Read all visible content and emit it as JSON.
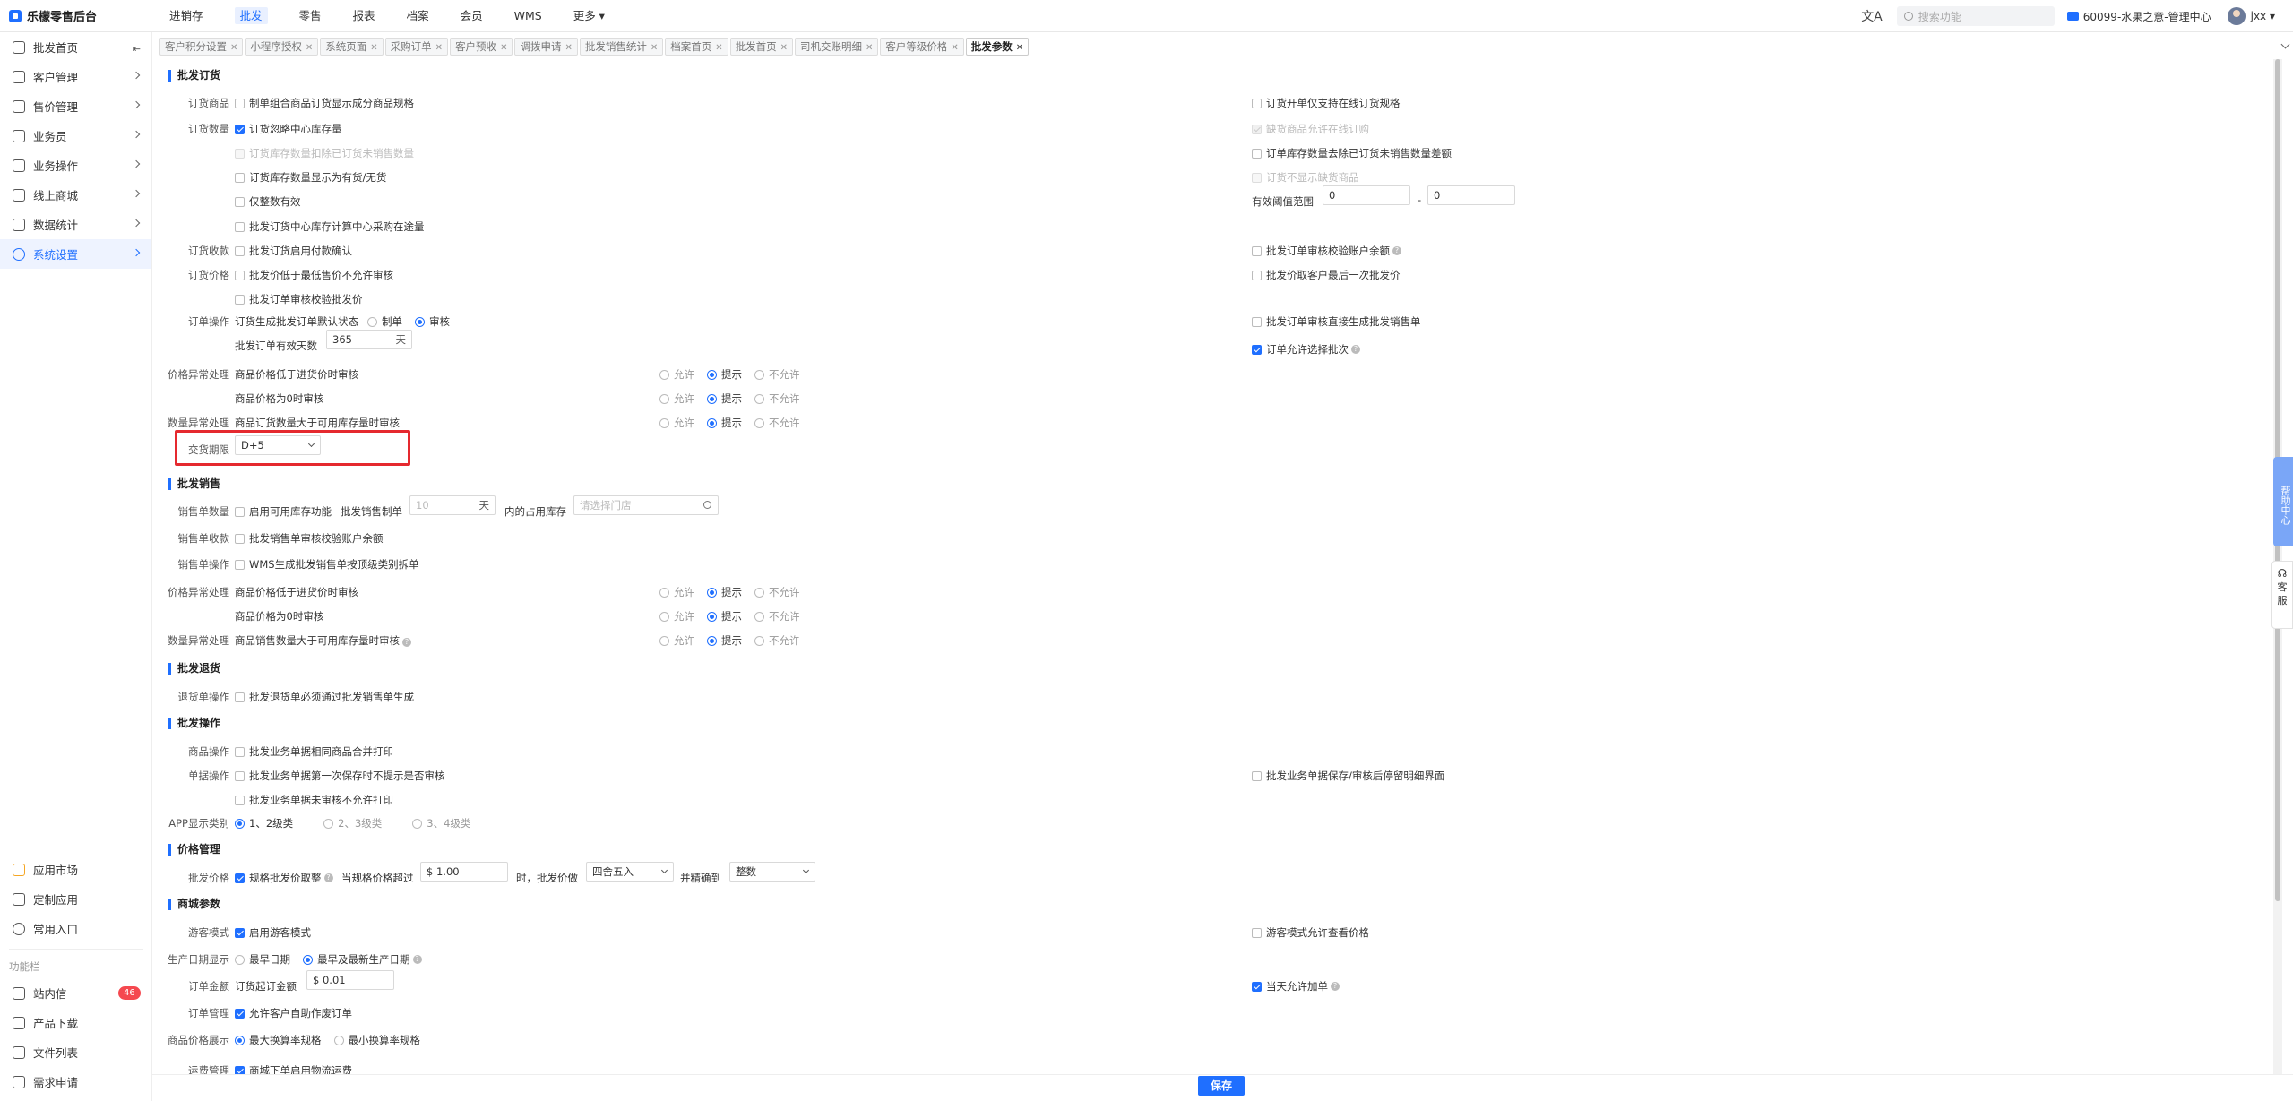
{
  "app": {
    "title": "乐檬零售后台"
  },
  "nav": [
    "进销存",
    "批发",
    "零售",
    "报表",
    "档案",
    "会员",
    "WMS",
    "更多"
  ],
  "topright": {
    "search_placeholder": "搜索功能",
    "org": "60099-水果之意-管理中心",
    "user": "jxx"
  },
  "sidebar": {
    "items": [
      "批发首页",
      "客户管理",
      "售价管理",
      "业务员",
      "业务操作",
      "线上商城",
      "数据统计",
      "系统设置"
    ],
    "bottom": [
      "应用市场",
      "定制应用",
      "常用入口"
    ],
    "section_label": "功能栏",
    "bottom2": [
      "站内信",
      "产品下载",
      "文件列表",
      "需求申请"
    ],
    "msg_badge": "46"
  },
  "tabs": [
    "客户积分设置",
    "小程序授权",
    "系统页面",
    "采购订单",
    "客户预收",
    "调拨申请",
    "批发销售统计",
    "档案首页",
    "批发首页",
    "司机交账明细",
    "客户等级价格",
    "批发参数"
  ],
  "sections": {
    "order": "批发订货",
    "sales": "批发销售",
    "returns": "批发退货",
    "ops": "批发操作",
    "price": "价格管理",
    "mall": "商城参数"
  },
  "order": {
    "row1_label": "订货商品",
    "row1_cb": "制单组合商品订货显示成分商品规格",
    "row1_right": "订货开单仅支持在线订货规格",
    "row2_label": "订货数量",
    "row2_cb1": "订货忽略中心库存量",
    "row2_right1": "缺货商品允许在线订购",
    "row2_cb2": "订货库存数量扣除已订货未销售数量",
    "row2_right2": "订单库存数量去除已订货未销售数量差额",
    "row2_cb3": "订货库存数量显示为有货/无货",
    "row2_right3": "订货不显示缺货商品",
    "row2_cb4": "仅整数有效",
    "valid_range_label": "有效阈值范围",
    "range_min": "0",
    "range_sep": "-",
    "range_max": "0",
    "row2_cb5": "批发订货中心库存计算中心采购在途量",
    "row3_label": "订货收款",
    "row3_cb": "批发订货启用付款确认",
    "row3_right": "批发订单审核校验账户余额",
    "row4_label": "订货价格",
    "row4_cb1": "批发价低于最低售价不允许审核",
    "row4_right": "批发价取客户最后一次批发价",
    "row4_cb2": "批发订单审核校验批发价",
    "row5_label": "订单操作",
    "row5_text": "订货生成批发订单默认状态",
    "row5_r1": "制单",
    "row5_r2": "审核",
    "row5_right": "批发订单审核直接生成批发销售单",
    "valid_days_label": "批发订单有效天数",
    "valid_days": "365",
    "valid_days_unit": "天",
    "row5_right2": "订单允许选择批次",
    "price_ex_label": "价格异常处理",
    "price_ex1": "商品价格低于进货价时审核",
    "price_ex2": "商品价格为0时审核",
    "qty_ex_label": "数量异常处理",
    "qty_ex1": "商品订货数量大于可用库存量时审核",
    "opt_allow": "允许",
    "opt_prompt": "提示",
    "opt_deny": "不允许",
    "delivery_label": "交货期限",
    "delivery_value": "D+5"
  },
  "sales": {
    "qty_label": "销售单数量",
    "qty_cb": "启用可用库存功能",
    "qty_text1": "批发销售制单",
    "qty_days": "10",
    "qty_unit": "天",
    "qty_text2": "内的占用库存",
    "store_placeholder": "请选择门店",
    "pay_label": "销售单收款",
    "pay_cb": "批发销售单审核校验账户余额",
    "op_label": "销售单操作",
    "op_cb": "WMS生成批发销售单按顶级类别拆单",
    "price_ex_label": "价格异常处理",
    "price_ex1": "商品价格低于进货价时审核",
    "price_ex2": "商品价格为0时审核",
    "qty_ex_label": "数量异常处理",
    "qty_ex1": "商品销售数量大于可用库存量时审核"
  },
  "returns": {
    "label": "退货单操作",
    "cb": "批发退货单必须通过批发销售单生成"
  },
  "ops": {
    "goods_label": "商品操作",
    "goods_cb": "批发业务单据相同商品合并打印",
    "doc_label": "单据操作",
    "doc_cb1": "批发业务单据第一次保存时不提示是否审核",
    "doc_right": "批发业务单据保存/审核后停留明细界面",
    "doc_cb2": "批发业务单据未审核不允许打印",
    "app_label": "APP显示类别",
    "app_r1": "1、2级类",
    "app_r2": "2、3级类",
    "app_r3": "3、4级类"
  },
  "price": {
    "label": "批发价格",
    "cb": "规格批发价取整",
    "text1": "当规格价格超过",
    "threshold": "$ 1.00",
    "text2": "时，批发价做",
    "rounding": "四舍五入",
    "text3": "并精确到",
    "precision": "整数"
  },
  "mall": {
    "guest_label": "游客模式",
    "guest_cb": "启用游客模式",
    "guest_right": "游客模式允许查看价格",
    "date_label": "生产日期显示",
    "date_r1": "最早日期",
    "date_r2": "最早及最新生产日期",
    "amount_label": "订单金额",
    "amount_text": "订货起订金额",
    "amount_value": "$ 0.01",
    "amount_right": "当天允许加单",
    "mgmt_label": "订单管理",
    "mgmt_cb": "允许客户自助作废订单",
    "spec_label": "商品价格展示",
    "spec_r1": "最大换算率规格",
    "spec_r2": "最小换算率规格",
    "partial_label": "运费管理",
    "partial_cb": "商城下单启用物流运费"
  },
  "side_widgets": {
    "help": "帮助中心",
    "kefu": "客服"
  },
  "save_button": "保存",
  "colors": {
    "accent": "#1f6fff",
    "highlight": "#e5292f"
  }
}
